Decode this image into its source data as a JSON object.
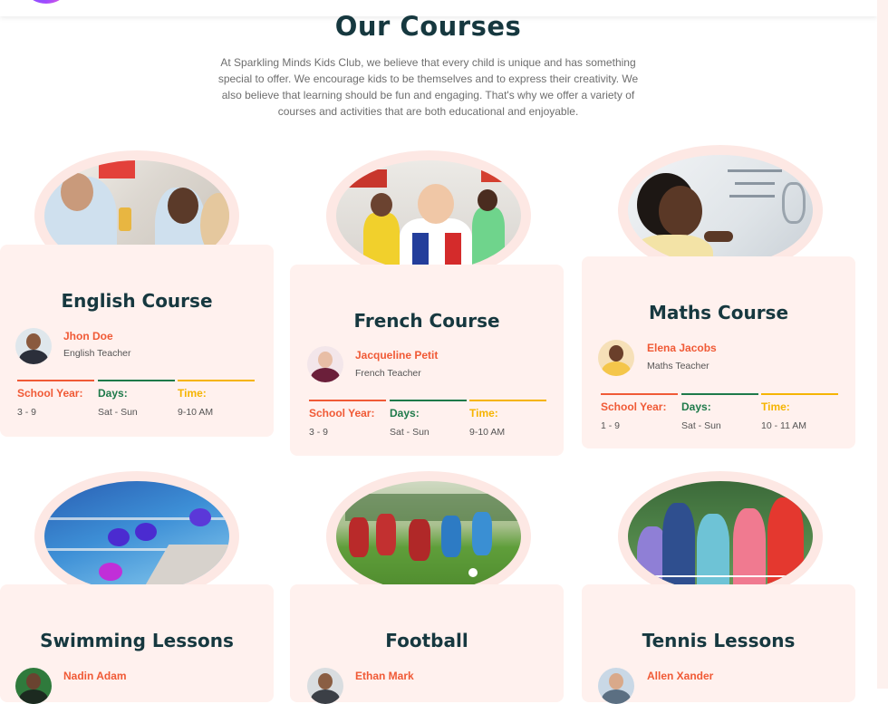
{
  "colors": {
    "heading": "#16383f",
    "accent_red": "#f05a36",
    "accent_green": "#1e7a4a",
    "accent_yellow": "#f5b400",
    "card_bg": "#fff1ee"
  },
  "section": {
    "title": "Our Courses",
    "intro": "At Sparkling Minds Kids Club, we believe that every child is unique and has something special to offer. We encourage kids to be themselves and to express their creativity. We also believe that learning should be fun and engaging. That's why we offer a variety of courses and activities that are both educational and enjoyable."
  },
  "labels": {
    "school_year": "School Year:",
    "days": "Days:",
    "time": "Time:"
  },
  "courses": [
    {
      "title": "English Course",
      "teacher": "Jhon Doe",
      "role": "English Teacher",
      "school_year": "3 - 9",
      "days": "Sat - Sun",
      "time": "9-10 AM",
      "image_icon": "classroom-photo-icon"
    },
    {
      "title": "French Course",
      "teacher": "Jacqueline Petit",
      "role": "French Teacher",
      "school_year": "3 - 9",
      "days": "Sat - Sun",
      "time": "9-10 AM",
      "image_icon": "kids-with-flags-photo-icon"
    },
    {
      "title": "Maths Course",
      "teacher": "Elena Jacobs",
      "role": "Maths Teacher",
      "school_year": "1 - 9",
      "days": "Sat - Sun",
      "time": "10 - 11 AM",
      "image_icon": "whiteboard-photo-icon"
    },
    {
      "title": "Swimming Lessons",
      "teacher": "Nadin Adam",
      "image_icon": "swimming-pool-photo-icon"
    },
    {
      "title": "Football",
      "teacher": "Ethan Mark",
      "image_icon": "football-field-photo-icon"
    },
    {
      "title": "Tennis Lessons",
      "teacher": "Allen Xander",
      "image_icon": "tennis-court-photo-icon"
    }
  ]
}
